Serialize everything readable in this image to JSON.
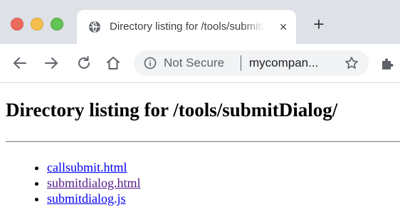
{
  "browser": {
    "tab": {
      "title": "Directory listing for /tools/submitDialog/",
      "close_glyph": "×"
    },
    "new_tab_glyph": "+",
    "omnibox": {
      "security_label": "Not Secure",
      "url": "mycompan..."
    },
    "colors": {
      "tabstrip": "#dee1e6",
      "omnibox_bg": "#f1f3f4",
      "close": "#ed6a5e",
      "minimize": "#f5bf4f",
      "maximize": "#61c454"
    },
    "icons": {
      "back": "arrow-left-icon",
      "forward": "arrow-right-icon",
      "reload": "reload-icon",
      "home": "home-icon",
      "info": "info-icon",
      "bookmark": "star-icon",
      "extensions": "puzzle-icon",
      "tab_favicon": "globe-icon"
    }
  },
  "page": {
    "title": "Directory listing for /tools/submitDialog/",
    "files": [
      {
        "name": "callsubmit.html",
        "visited": false
      },
      {
        "name": "submitdialog.html",
        "visited": true
      },
      {
        "name": "submitdialog.js",
        "visited": false
      }
    ],
    "colors": {
      "link": "#0000ee",
      "visited_link": "#551a8b"
    }
  }
}
